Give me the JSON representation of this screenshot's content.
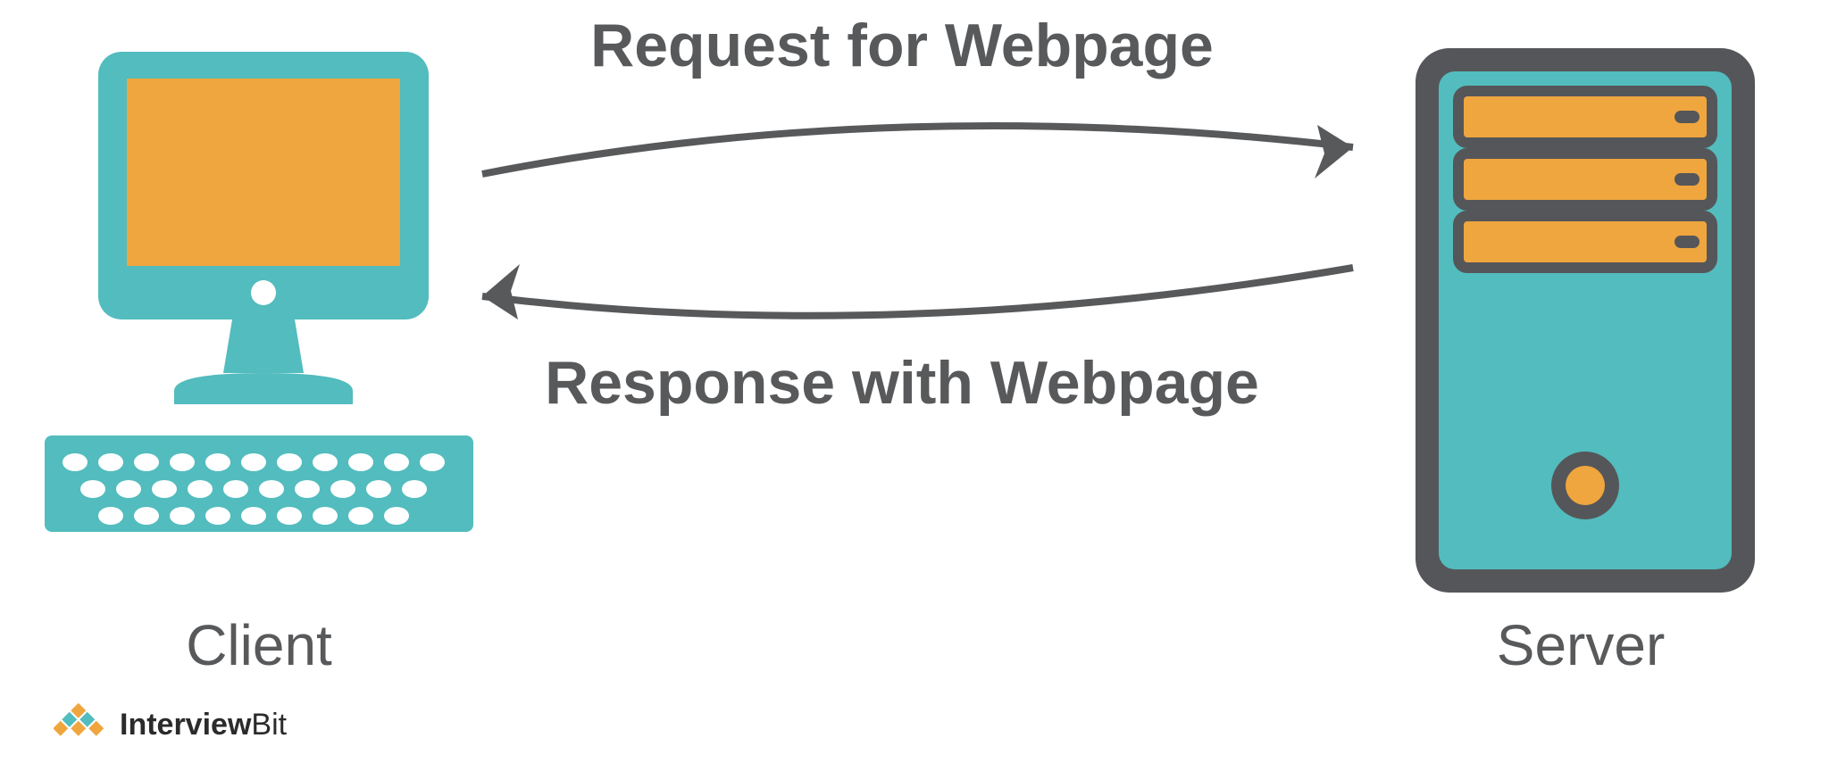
{
  "labels": {
    "request": "Request for Webpage",
    "response": "Response with Webpage",
    "client": "Client",
    "server": "Server"
  },
  "brand": {
    "name_bold": "Interview",
    "name_light": "Bit"
  },
  "colors": {
    "teal": "#52bcbe",
    "orange": "#efa63e",
    "gray": "#58595b",
    "dark_gray": "#555659",
    "white": "#ffffff"
  }
}
